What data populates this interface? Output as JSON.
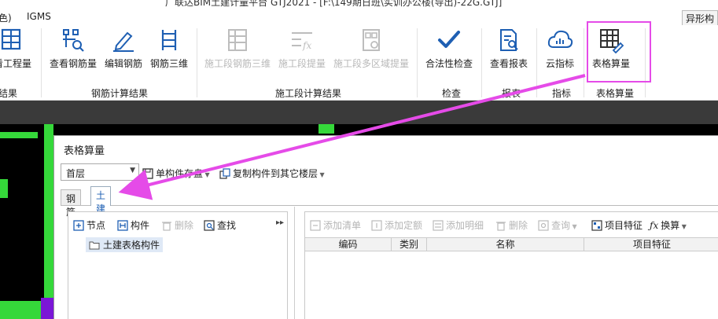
{
  "window": {
    "title": "广联达BIM土建计量平台 GTJ2021 - [F:\\149期日班\\实训办公楼(导出)-22G.GTJ]"
  },
  "menubar": {
    "items": [
      "色)",
      "IGMS"
    ],
    "special_label": "异形构"
  },
  "ribbon": {
    "buttons": [
      {
        "label": "看工程量",
        "icon": "table-sigma-icon",
        "enabled": true
      },
      {
        "label": "查看钢筋量",
        "icon": "rebar-view-icon",
        "enabled": true
      },
      {
        "label": "编辑钢筋",
        "icon": "pen-edit-icon",
        "enabled": true
      },
      {
        "label": "钢筋三维",
        "icon": "rebar-3d-icon",
        "enabled": true
      },
      {
        "label": "施工段钢筋三维",
        "icon": "stage-rebar-3d-icon",
        "enabled": false
      },
      {
        "label": "施工段提量",
        "icon": "stage-fx-icon",
        "enabled": false
      },
      {
        "label": "施工段多区域提量",
        "icon": "stage-multi-icon",
        "enabled": false
      },
      {
        "label": "合法性检查",
        "icon": "check-mark-icon",
        "enabled": true
      },
      {
        "label": "查看报表",
        "icon": "report-search-icon",
        "enabled": true
      },
      {
        "label": "云指标",
        "icon": "cloud-metric-icon",
        "enabled": true
      },
      {
        "label": "表格算量",
        "icon": "table-pen-icon",
        "enabled": true
      }
    ],
    "groups": [
      "结果",
      "钢筋计算结果",
      "施工段计算结果",
      "检查",
      "报表",
      "指标",
      "表格算量"
    ]
  },
  "dialog": {
    "title": "表格算量",
    "floor": "首层",
    "toolbar": {
      "single_build": "单构件存盘",
      "copy_to_floor": "复制构件到其它楼层"
    },
    "tabs": [
      "钢筋",
      "土建"
    ],
    "active_tab": "土建",
    "left_toolbar": [
      "节点",
      "构件",
      "删除",
      "查找"
    ],
    "tree_item": "土建表格构件",
    "right_toolbar": [
      "添加清单",
      "添加定额",
      "添加明细",
      "删除",
      "查询",
      "项目特征",
      "换算"
    ],
    "columns": [
      "编码",
      "类别",
      "名称",
      "项目特征"
    ]
  },
  "colors": {
    "highlight": "#e54be8",
    "arrow": "#e54be8",
    "accent": "#1e5fb3",
    "canvas_green": "#35d83a",
    "canvas_purple": "#7b16d6"
  }
}
